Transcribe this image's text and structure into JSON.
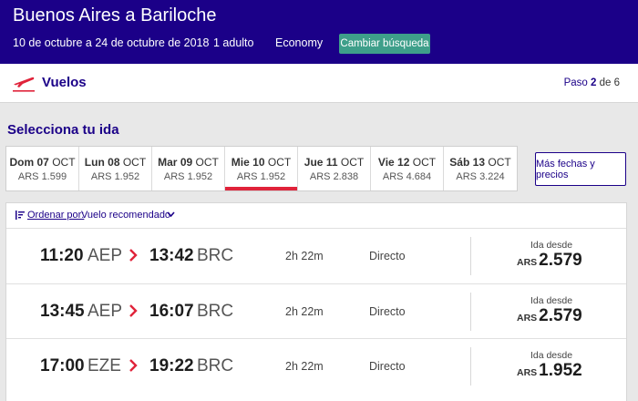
{
  "header": {
    "route": "Buenos Aires a Bariloche",
    "dates": "10 de octubre a 24 de octubre de 2018",
    "passengers": "1 adulto",
    "cabin": "Economy",
    "change_search_label": "Cambiar búsqueda"
  },
  "flights_bar": {
    "label": "Vuelos",
    "step_prefix": "Paso",
    "step_current": "2",
    "step_suffix": "de 6"
  },
  "selection": {
    "title": "Selecciona tu ida",
    "dates": [
      {
        "weekday": "Dom",
        "day": "07",
        "month": "OCT",
        "price": "ARS 1.599"
      },
      {
        "weekday": "Lun",
        "day": "08",
        "month": "OCT",
        "price": "ARS 1.952"
      },
      {
        "weekday": "Mar",
        "day": "09",
        "month": "OCT",
        "price": "ARS 1.952"
      },
      {
        "weekday": "Mie",
        "day": "10",
        "month": "OCT",
        "price": "ARS 1.952"
      },
      {
        "weekday": "Jue",
        "day": "11",
        "month": "OCT",
        "price": "ARS 2.838"
      },
      {
        "weekday": "Vie",
        "day": "12",
        "month": "OCT",
        "price": "ARS 4.684"
      },
      {
        "weekday": "Sáb",
        "day": "13",
        "month": "OCT",
        "price": "ARS 3.224"
      }
    ],
    "selected_date_index": 3,
    "more_dates_label": "Más fechas y precios"
  },
  "sort": {
    "label": "Ordenar por:",
    "value": "Vuelo recomendado"
  },
  "flights": [
    {
      "dep_time": "11:20",
      "dep_code": "AEP",
      "arr_time": "13:42",
      "arr_code": "BRC",
      "duration": "2h 22m",
      "stops": "Directo",
      "price_label": "Ida desde",
      "currency": "ARS",
      "price": "2.579"
    },
    {
      "dep_time": "13:45",
      "dep_code": "AEP",
      "arr_time": "16:07",
      "arr_code": "BRC",
      "duration": "2h 22m",
      "stops": "Directo",
      "price_label": "Ida desde",
      "currency": "ARS",
      "price": "2.579"
    },
    {
      "dep_time": "17:00",
      "dep_code": "EZE",
      "arr_time": "19:22",
      "arr_code": "BRC",
      "duration": "2h 22m",
      "stops": "Directo",
      "price_label": "Ida desde",
      "currency": "ARS",
      "price": "1.952"
    }
  ],
  "colors": {
    "brand": "#1b0088",
    "accent": "#e0233a",
    "button": "#3e9f8a"
  },
  "icons": {
    "flights": "plane-takeoff-icon",
    "sort": "sort-icon",
    "sort_chevron": "chevron-down-icon",
    "flight_arrow": "chevron-right-icon"
  }
}
